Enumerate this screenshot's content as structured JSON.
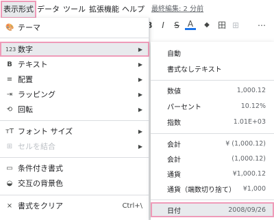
{
  "menubar": {
    "items": [
      "表示形式",
      "データ",
      "ツール",
      "拡張機能",
      "ヘルプ"
    ],
    "last_edit": "最終編集: 2 分前"
  },
  "toolbar": {
    "icons": [
      "bold-icon",
      "italic-icon",
      "strikethrough-icon",
      "text-color-icon",
      "fill-color-icon",
      "borders-icon",
      "merge-cells-icon",
      "more-icon"
    ],
    "glyphs": [
      "B",
      "I",
      "S",
      "A",
      "◆",
      "田",
      "⊞",
      "⋯"
    ]
  },
  "format_menu": {
    "items": [
      {
        "icon": "🎨",
        "label": "テーマ"
      },
      {
        "icon": "123",
        "label": "数字",
        "arrow": "▶"
      },
      {
        "icon": "B",
        "label": "テキスト",
        "arrow": "▶"
      },
      {
        "icon": "≡",
        "label": "配置",
        "arrow": "▶"
      },
      {
        "icon": "⇥",
        "label": "ラッピング",
        "arrow": "▶"
      },
      {
        "icon": "⟲",
        "label": "回転",
        "arrow": "▶"
      },
      {
        "icon": "тT",
        "label": "フォント サイズ",
        "arrow": "▶"
      },
      {
        "icon": "⊞",
        "label": "セルを結合",
        "arrow": "▶"
      },
      {
        "icon": "▭",
        "label": "条件付き書式"
      },
      {
        "icon": "◒",
        "label": "交互の背景色"
      },
      {
        "icon": "⨯",
        "label": "書式をクリア",
        "shortcut": "Ctrl+\\"
      }
    ]
  },
  "number_menu": {
    "items": [
      {
        "label": "自動",
        "value": ""
      },
      {
        "label": "書式なしテキスト",
        "value": ""
      },
      {
        "label": "数値",
        "value": "1,000.12"
      },
      {
        "label": "パーセント",
        "value": "10.12%"
      },
      {
        "label": "指数",
        "value": "1.01E+03"
      },
      {
        "label": "会計",
        "value": "¥ (1,000.12)"
      },
      {
        "label": "会計",
        "value": "(1,000.12)"
      },
      {
        "label": "通貨",
        "value": "¥1,000.12"
      },
      {
        "label": "通貨（端数切り捨て）",
        "value": "¥1,000"
      },
      {
        "label": "日付",
        "value": "2008/09/26"
      }
    ]
  }
}
